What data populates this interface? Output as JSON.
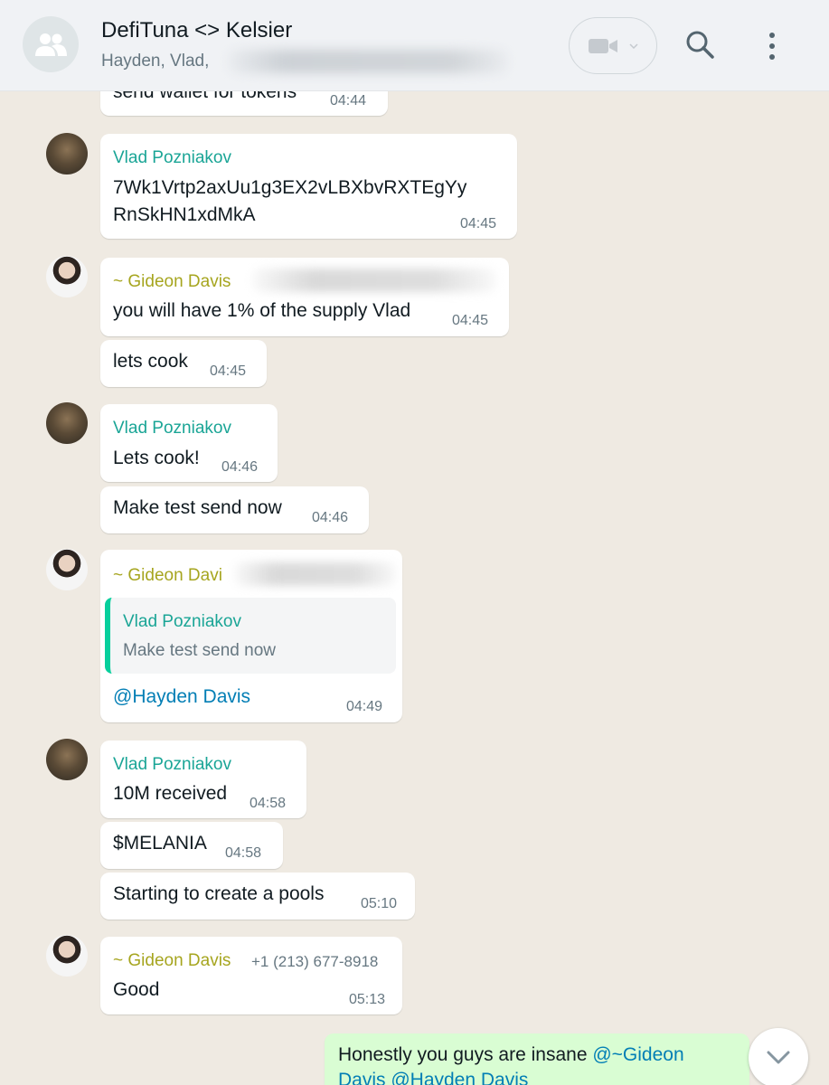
{
  "header": {
    "title": "DefiTuna <> Kelsier",
    "participants": "Hayden, Vlad,"
  },
  "icons": {
    "group": "group-avatar-icon",
    "video": "video-call-icon",
    "search": "search-icon",
    "menu": "kebab-menu-icon",
    "scroll": "chevron-down-icon"
  },
  "colors": {
    "vlad_name": "#1aa596",
    "gideon_name": "#a6a51f",
    "mention": "#027eb5",
    "outgoing_bubble": "#d9fdd3",
    "chat_background": "#efeae2"
  },
  "messages": [
    {
      "text": "send wallet for tokens",
      "time": "04:44"
    },
    {
      "sender": "Vlad Pozniakov",
      "line1": "7Wk1Vrtp2axUu1g3EX2vLBXbvRXTEgYy",
      "line2": "RnSkHN1xdMkA",
      "time": "04:45"
    },
    {
      "sender": "~ Gideon Davis",
      "text": "you will have 1% of the supply Vlad",
      "time": "04:45"
    },
    {
      "text": "lets cook",
      "time": "04:45"
    },
    {
      "sender": "Vlad Pozniakov",
      "text": "Lets cook!",
      "time": "04:46"
    },
    {
      "text": "Make test send now",
      "time": "04:46"
    },
    {
      "sender": "~ Gideon Davi",
      "quote_sender": "Vlad Pozniakov",
      "quote_text": "Make test send now",
      "text": "@Hayden Davis",
      "time": "04:49"
    },
    {
      "sender": "Vlad Pozniakov",
      "text": "10M received",
      "time": "04:58"
    },
    {
      "text": "$MELANIA",
      "time": "04:58"
    },
    {
      "text": "Starting to create a pools",
      "time": "05:10"
    },
    {
      "sender": "~ Gideon Davis",
      "phone": "+1 (213) 677-8918",
      "text": "Good",
      "time": "05:13"
    },
    {
      "text_plain": "Honestly you guys are insane ",
      "mention1": "@~Gideon",
      "mention2": "Davis @Hayden Davis"
    }
  ]
}
